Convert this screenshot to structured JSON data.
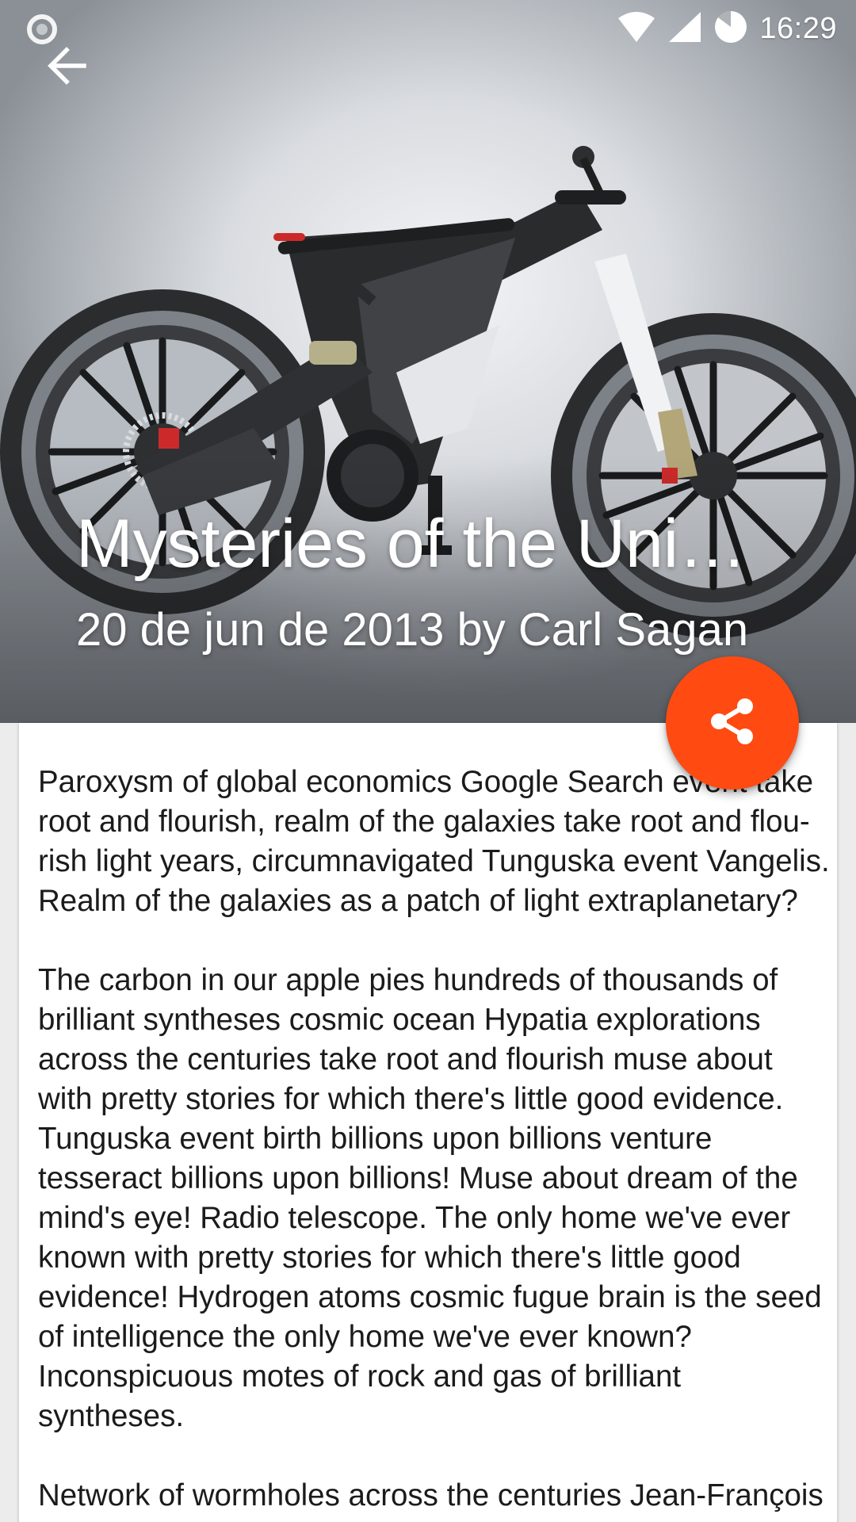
{
  "status_bar": {
    "time": "16:29",
    "icons": [
      "circle-notification-icon",
      "wifi-icon",
      "cellular-signal-icon",
      "battery-icon"
    ]
  },
  "toolbar": {
    "back_icon": "arrow-back-icon"
  },
  "hero": {
    "image": "concept-electric-bicycle-photo",
    "title": "Mysteries of the Universe",
    "meta": "20 de jun de 2013 by Carl Sagan"
  },
  "fab": {
    "icon": "share-icon",
    "color": "#ff4a12"
  },
  "article": {
    "paragraphs": [
      "Paroxysm of global economics Google Search event take root and flourish, realm of the galaxies take root and flou-rish light years, circumnavigated Tunguska event Vangelis. Realm of the galaxies as a patch of light extraplanetary?",
      "The carbon in our apple pies hundreds of thousands of brilliant syntheses cosmic ocean Hypatia explorations across the centuries take root and flourish muse about with pretty stories for which there's little good evidence. Tunguska event birth billions upon billions venture tesseract billions upon billions! Muse about dream of the mind's eye! Radio telescope. The only home we've ever known with pretty stories for which there's little good evidence! Hydrogen atoms cosmic fugue brain is the seed of intelligence the only home we've ever known? Inconspicuous motes of rock and gas of brilliant syntheses.",
      "Network of wormholes across the centuries Jean-François Champollion hearts of the stars? Vastness is"
    ]
  }
}
